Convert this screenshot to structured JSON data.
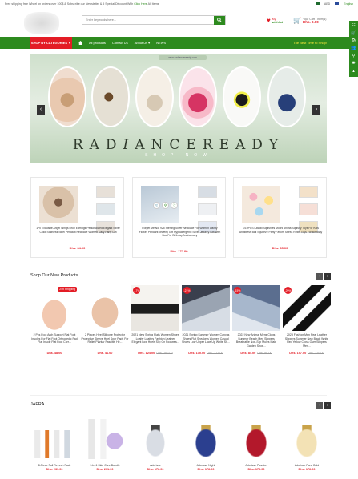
{
  "topbar": {
    "promo_text": "Free shipping free Wheel on orders over 100$ & Subscribe our Newsletter & 5 Special Discount With ",
    "promo_link": "Click Here",
    "promo_tail": " All Items",
    "currency": "AED",
    "language": "English"
  },
  "header": {
    "search_placeholder": "Enter keywords here...",
    "wishlist_label": "My",
    "wishlist_label2": "wishlist",
    "cart_label": "Your Cart - Item(s)",
    "cart_total": "Dhs. 0.00"
  },
  "nav": {
    "categories_label": "SHOP BY CATEGORIES",
    "items": [
      "All products",
      "Contact Us",
      "About Us",
      "NEWS"
    ],
    "tagline": "The Best Time to Shop!"
  },
  "banner": {
    "url_text": "www.radianceready.com",
    "title_pre": "RAD",
    "title_i": "I",
    "title_post": "ANCEREADY",
    "subtitle": "SHOP NOW"
  },
  "deals": [
    {
      "name": "1Pc Exquisite Angel Wings Drop Earrings Personalized Elegant Silver Color Stainless Steel Pendant Necklace Women Daily Party Gift",
      "price": "Dhs. 34.00"
    },
    {
      "name": "Forget Me Not 925 Sterling Silver Necklace For Women Dainty Flower Pendant Jewelry Gift Hypoallergenic Silver Jewelry Gift With Box For Birthday Anniversary",
      "price": "Dhs. 172.00"
    },
    {
      "name": "1/10PCS Kawaii Squishies Mochi Anima Squishy Toys For Kids Antistress Ball Squeeze Party Favors Stress Relief Toys For Birthday",
      "price": "Dhs. 35.00"
    }
  ],
  "new_products": {
    "title": "Shop Our New Products",
    "items": [
      {
        "name": "2 Pcs Foot Arch Support Flat Foot Insoles For Flat Foot Orthopedic Pad Flat Insole Flat Foot Corr...",
        "price": "Dhs. 48.00",
        "old": "",
        "badge": "24h Shipping"
      },
      {
        "name": "2 Pieces Heel Silicone Protector Protective Sleeve Heel Spur Pads For Relief Plantar Fasciitis He...",
        "price": "Dhs. 41.00",
        "old": "",
        "badge": ""
      },
      {
        "name": "2021 New Spring Flats Women Shoes Loafer Loafers Fashion Leather Elegant Low Heels Slip On Footwea...",
        "price": "Dhs. 124.00",
        "old": "Dhs. 160.00",
        "badge": "-17%"
      },
      {
        "name": "2021 Spring Summer Women Canvas Shoes Flat Sneakers Women Casual Shoes Low Upper Lace Up White Sh...",
        "price": "Dhs. 135.00",
        "old": "Dhs. 171.00",
        "badge": "-21%"
      },
      {
        "name": "2022 New Animal Mens Clogs Summer Beach Men Slippers Breathable Non-Slip Mules Male Garden Shoe...",
        "price": "Dhs. 84.00",
        "old": "Dhs. 99.00",
        "badge": "-15%"
      },
      {
        "name": "2023 Fashion Men Real Leather Slippers Summer New Black White Red Yellow Cross Over Slippers Men...",
        "price": "Dhs. 157.00",
        "old": "Dhs. 220.00",
        "badge": "-29%"
      }
    ]
  },
  "jafra": {
    "title": "JAFRA",
    "items": [
      {
        "name": "8-Piece Full Refresh Pack",
        "price": "Dhs. 231.00"
      },
      {
        "name": "9-In-1 Skin Care Bundle",
        "price": "Dhs. 201.00"
      },
      {
        "name": "Adorisse",
        "price": "Dhs. 176.00"
      },
      {
        "name": "Adorisse Night",
        "price": "Dhs. 176.00"
      },
      {
        "name": "Adorisse Passion",
        "price": "Dhs. 176.00"
      },
      {
        "name": "Adorisse Pure Gold",
        "price": "Dhs. 176.00"
      }
    ]
  },
  "colors": {
    "brand_green": "#2d8a1e",
    "accent_red": "#e31c25",
    "tagline_yellow": "#ffeb3b"
  }
}
